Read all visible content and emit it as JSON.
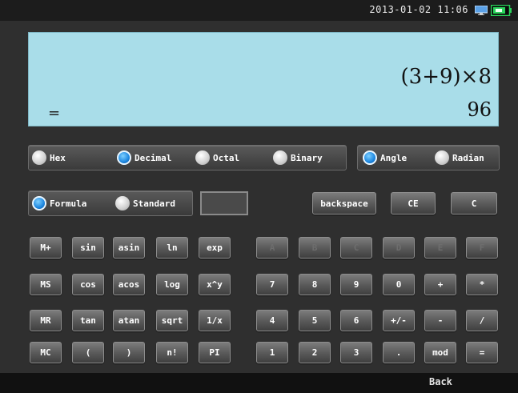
{
  "status": {
    "datetime": "2013-01-02 11:06"
  },
  "display": {
    "expression": "(3+9)×8",
    "equals": "=",
    "result": "96"
  },
  "base_modes": [
    "Hex",
    "Decimal",
    "Octal",
    "Binary"
  ],
  "base_selected": "Decimal",
  "angle_modes": [
    "Angle",
    "Radian"
  ],
  "angle_selected": "Angle",
  "input_modes": [
    "Formula",
    "Standard"
  ],
  "input_selected": "Formula",
  "controls": {
    "backspace": "backspace",
    "ce": "CE",
    "c": "C"
  },
  "sci_keys": [
    [
      "M+",
      "sin",
      "asin",
      "ln",
      "exp"
    ],
    [
      "MS",
      "cos",
      "acos",
      "log",
      "x^y"
    ],
    [
      "MR",
      "tan",
      "atan",
      "sqrt",
      "1/x"
    ],
    [
      "MC",
      "(",
      ")",
      "n!",
      "PI"
    ]
  ],
  "num_keys": [
    [
      "A",
      "B",
      "C",
      "D",
      "E",
      "F"
    ],
    [
      "7",
      "8",
      "9",
      "0",
      "+",
      "*"
    ],
    [
      "4",
      "5",
      "6",
      "+/-",
      "-",
      "/"
    ],
    [
      "1",
      "2",
      "3",
      ".",
      "mod",
      "="
    ]
  ],
  "disabled_row": 0,
  "bottom": {
    "back": "Back"
  },
  "colors": {
    "display_bg": "#a9dde9",
    "radio_selected": "#1d87e0",
    "background": "#2f2f2f"
  }
}
